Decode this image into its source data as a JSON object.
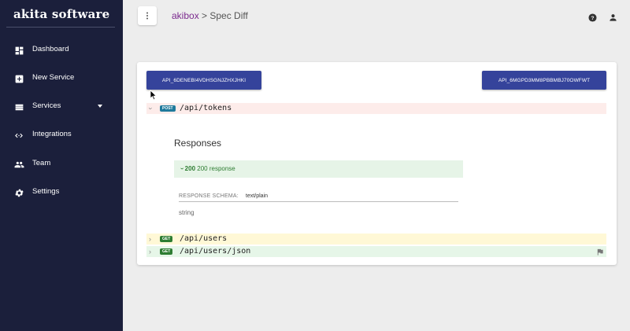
{
  "app": {
    "logo": "akita software"
  },
  "sidebar": {
    "items": [
      {
        "label": "Dashboard",
        "icon": "dashboard-icon"
      },
      {
        "label": "New Service",
        "icon": "add-box-icon"
      },
      {
        "label": "Services",
        "icon": "list-icon"
      },
      {
        "label": "Integrations",
        "icon": "code-icon"
      },
      {
        "label": "Team",
        "icon": "people-icon"
      },
      {
        "label": "Settings",
        "icon": "gear-icon"
      }
    ]
  },
  "header": {
    "breadcrumb_link": "akibox",
    "breadcrumb_sep": " > ",
    "breadcrumb_current": "Spec Diff",
    "menu_icon": "more-vert-icon",
    "help_icon": "help-icon",
    "user_icon": "person-icon"
  },
  "diff": {
    "left_spec": "API_6DENEBI4VDHSGNJZHXJHKI",
    "right_spec": "API_6MGPD3MM8PBBMBJ70OWFWT",
    "endpoints": [
      {
        "method": "POST",
        "path": "/api/tokens",
        "state": "removed",
        "color": "#fdecea"
      },
      {
        "method": "GET",
        "path": "/api/users",
        "state": "changed",
        "color": "#fff8d6"
      },
      {
        "method": "GET",
        "path": "/api/users/json",
        "state": "added",
        "color": "#e6f6e8"
      }
    ],
    "responses_title": "Responses",
    "response_code": "200",
    "response_desc": "200 response",
    "schema_label": "RESPONSE SCHEMA:",
    "schema_content_type": "text/plain",
    "schema_type": "string"
  },
  "colors": {
    "sidebar_bg": "#1b1f3b",
    "button_bg": "#35439b",
    "post_badge": "#1f7a9c",
    "get_badge": "#2e7d32",
    "breadcrumb_link": "#7b2a8e"
  }
}
